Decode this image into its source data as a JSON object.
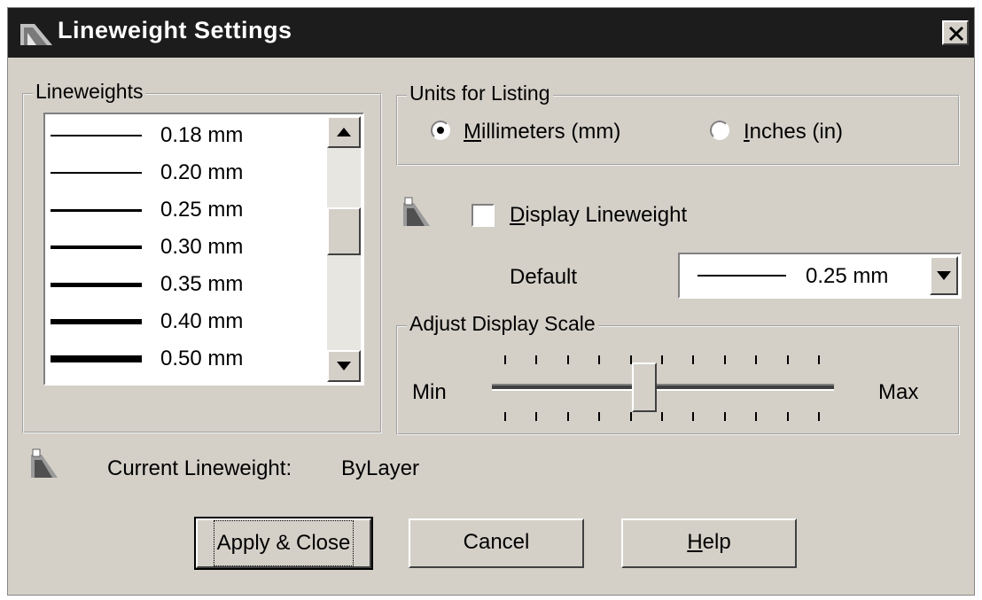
{
  "window": {
    "title": "Lineweight Settings"
  },
  "lineweights": {
    "group_label": "Lineweights",
    "items": [
      {
        "label": "0.18 mm",
        "mm": 0.18
      },
      {
        "label": "0.20 mm",
        "mm": 0.2
      },
      {
        "label": "0.25 mm",
        "mm": 0.25
      },
      {
        "label": "0.30 mm",
        "mm": 0.3
      },
      {
        "label": "0.35 mm",
        "mm": 0.35
      },
      {
        "label": "0.40 mm",
        "mm": 0.4
      },
      {
        "label": "0.50 mm",
        "mm": 0.5
      }
    ]
  },
  "units": {
    "group_label": "Units for Listing",
    "millimeters": {
      "label": "Millimeters (mm)",
      "mnemonic": "M",
      "rest": "illimeters (mm)",
      "selected": true
    },
    "inches": {
      "label": "Inches (in)",
      "mnemonic": "I",
      "rest": "nches (in)",
      "selected": false
    }
  },
  "display_lineweight": {
    "label": "Display Lineweight",
    "mnemonic": "D",
    "rest": "isplay Lineweight",
    "checked": false
  },
  "default": {
    "label": "Default",
    "value": "0.25 mm"
  },
  "display_scale": {
    "group_label": "Adjust Display Scale",
    "min_label": "Min",
    "max_label": "Max",
    "level": 0.45,
    "tick_count": 11
  },
  "current": {
    "label": "Current Lineweight:",
    "value": "ByLayer"
  },
  "buttons": {
    "apply": "Apply & Close",
    "cancel": "Cancel",
    "help": {
      "label": "Help",
      "mnemonic": "H",
      "rest": "elp"
    }
  }
}
